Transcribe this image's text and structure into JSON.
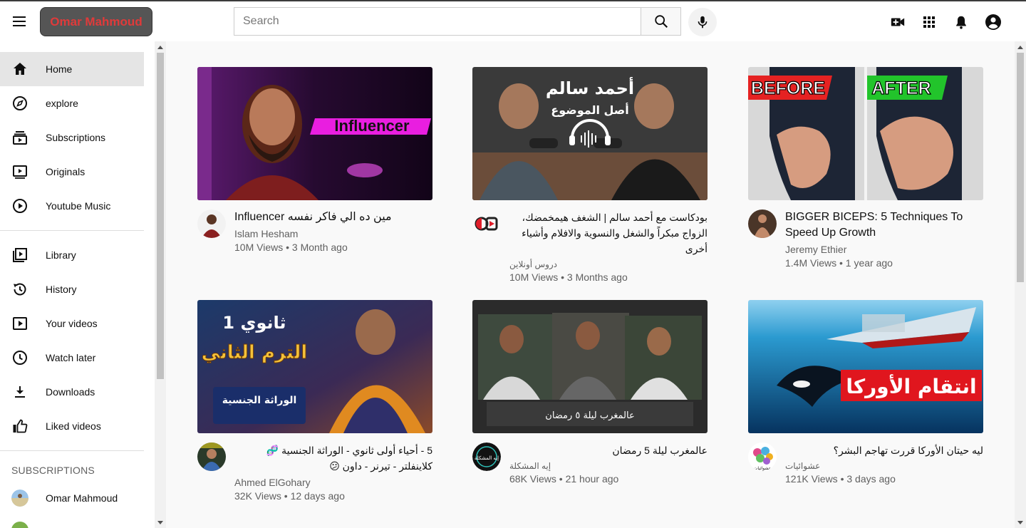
{
  "header": {
    "brand": "Omar Mahmoud",
    "search_placeholder": "Search"
  },
  "sidebar": {
    "items": [
      {
        "label": "Home",
        "icon": "home-icon"
      },
      {
        "label": "explore",
        "icon": "compass-icon"
      },
      {
        "label": "Subscriptions",
        "icon": "subscriptions-icon"
      },
      {
        "label": "Originals",
        "icon": "originals-icon"
      },
      {
        "label": "Youtube Music",
        "icon": "play-circle-icon"
      },
      {
        "label": "Library",
        "icon": "library-icon"
      },
      {
        "label": "History",
        "icon": "history-icon"
      },
      {
        "label": "Your videos",
        "icon": "your-videos-icon"
      },
      {
        "label": "Watch later",
        "icon": "clock-icon"
      },
      {
        "label": "Downloads",
        "icon": "download-icon"
      },
      {
        "label": "Liked videos",
        "icon": "thumbs-up-icon"
      }
    ],
    "subscriptions_title": "SUBSCRIPTIONS",
    "subscriptions": [
      {
        "label": "Omar Mahmoud"
      }
    ]
  },
  "videos": [
    {
      "title": "Influencer مين ده الي فاكر نفسه",
      "channel": "Islam Hesham",
      "stats": "10M Views • 3 Month ago",
      "thumb_text": "Influencer"
    },
    {
      "title": "بودكاست مع أحمد سالم | الشغف هيمخمضك، الزواج مبكراً والشغل والنسوية والافلام وأشياء أخرى",
      "channel": "دروس أونلاين",
      "stats": "10M Views • 3 Months ago",
      "thumb_text": "أحمد سالم",
      "thumb_sub": "أصل الموضوع"
    },
    {
      "title": "BIGGER BICEPS: 5 Techniques To Speed Up Growth",
      "channel": "Jeremy Ethier",
      "stats": "1.4M Views • 1 year ago",
      "thumb_text": "BEFORE",
      "thumb_text2": "AFTER"
    },
    {
      "title": "5 - أحياء أولى ثانوي - الوراثة الجنسية 🧬 كلاينفلتر - تيرنر - داون 😕",
      "channel": "Ahmed ElGohary",
      "stats": "32K Views • 12 days ago",
      "thumb_text": "1 ثانوي",
      "thumb_sub": "الترم الثاني",
      "thumb_sub2": "الوراثة الجنسية"
    },
    {
      "title": "عالمغرب ليلة 5 رمضان",
      "channel": "إيه المشكلة",
      "stats": "68K Views • 21 hour ago",
      "thumb_text": "عالمغرب ليلة ٥ رمضان",
      "avatar_text": "إيه المشكلة"
    },
    {
      "title": "ليه حيتان الأوركا قررت تهاجم البشر؟",
      "channel": "عشوائيات",
      "stats": "121K Views • 3 days ago",
      "thumb_text": "انتقام الأوركا",
      "avatar_text": "عشوائيات"
    }
  ],
  "colors": {
    "brand_text": "#e03a3a",
    "brand_bg": "#555555",
    "active_nav": "#e5e5e5"
  }
}
